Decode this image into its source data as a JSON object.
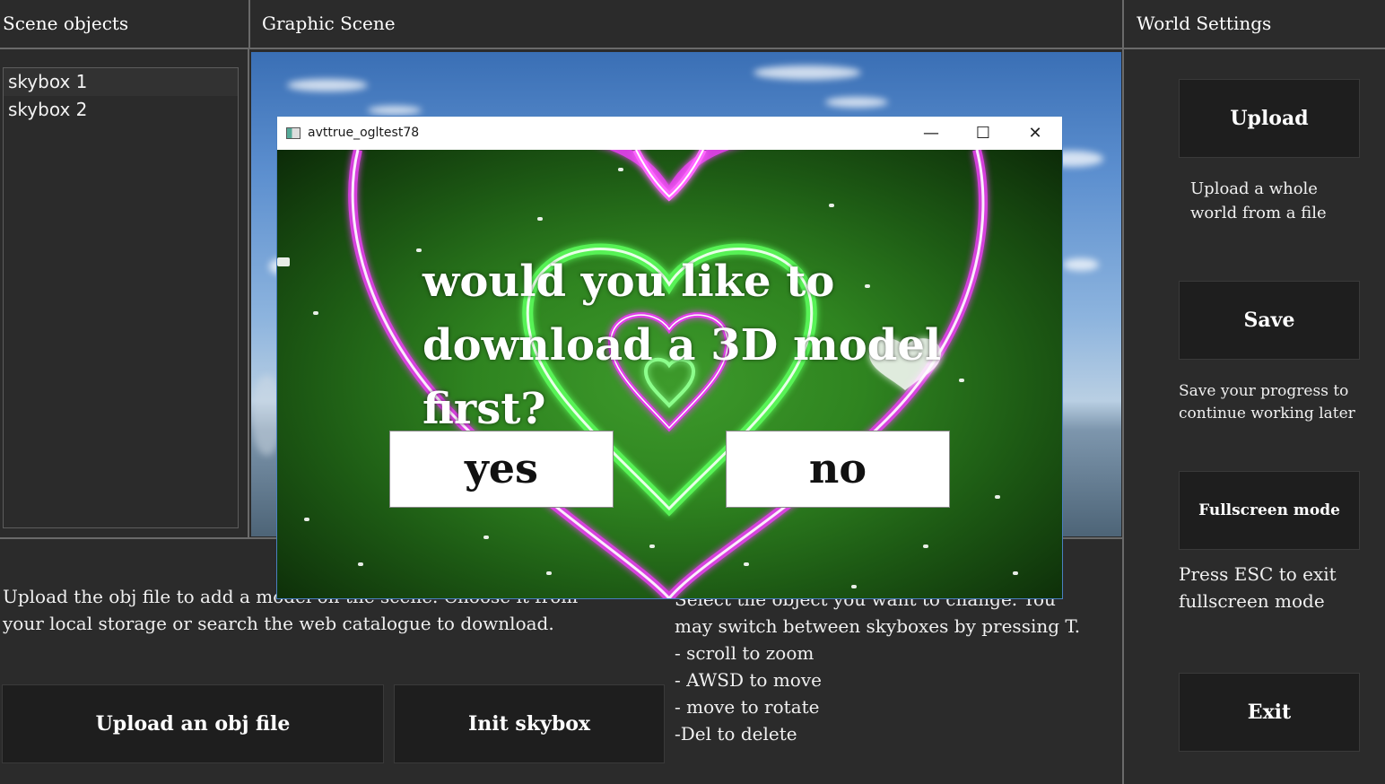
{
  "headers": {
    "scene_objects": "Scene objects",
    "graphic_scene": "Graphic Scene",
    "world_settings": "World Settings"
  },
  "scene_objects": {
    "items": [
      "skybox 1",
      "skybox 2"
    ],
    "selected_index": 0
  },
  "dialog": {
    "window_title": "avttrue_ogltest78",
    "question_line1": "would you like to",
    "question_line2": "download a 3D model first?",
    "yes_label": "yes",
    "no_label": "no",
    "minimize_glyph": "—",
    "maximize_glyph": "☐",
    "close_glyph": "✕"
  },
  "bottom": {
    "upload_desc_line1": "Upload the obj file to add a model on the scene. Choose it from",
    "upload_desc_line2": "your local storage or search the web catalogue to download.",
    "upload_obj_label": "Upload an obj file",
    "init_skybox_label": "Init skybox",
    "instructions": [
      "Select the object you want to change. You",
      "may switch between skyboxes by pressing T.",
      "- scroll to zoom",
      "- AWSD to move",
      "- move to rotate",
      "-Del to delete"
    ]
  },
  "world_settings": {
    "upload_label": "Upload",
    "upload_desc_line1": "Upload a whole",
    "upload_desc_line2": "world from a file",
    "save_label": "Save",
    "save_desc_line1": "Save your progress to",
    "save_desc_line2": "continue working later",
    "fullscreen_label": "Fullscreen mode",
    "fullscreen_desc_line1": "Press ESC to exit",
    "fullscreen_desc_line2": "fullscreen mode",
    "exit_label": "Exit"
  },
  "colors": {
    "background": "#2b2b2b",
    "button_bg": "#1e1e1e",
    "divider": "#6a6a6a",
    "neon_pink": "#e040e8",
    "neon_green": "#5cff5c",
    "dialog_bg": "#2f8420"
  }
}
